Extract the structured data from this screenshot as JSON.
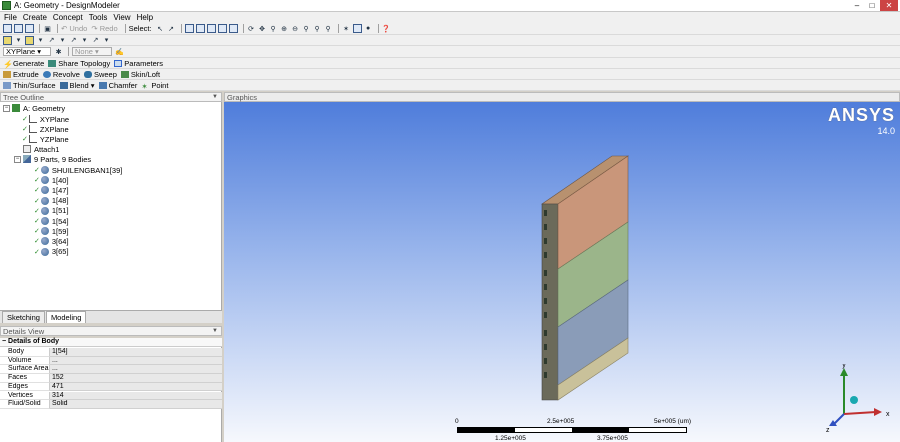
{
  "window": {
    "title": "A: Geometry - DesignModeler"
  },
  "menu": [
    "File",
    "Create",
    "Concept",
    "Tools",
    "View",
    "Help"
  ],
  "toolbar1": {
    "undo": "Undo",
    "redo": "Redo",
    "select": "Select:"
  },
  "plane_toolbar": {
    "plane": "XYPlane",
    "sketch": "None"
  },
  "feature_toolbar": {
    "generate": "Generate",
    "share": "Share Topology",
    "params": "Parameters"
  },
  "ops_toolbar": {
    "extrude": "Extrude",
    "revolve": "Revolve",
    "sweep": "Sweep",
    "skin": "Skin/Loft"
  },
  "ops_toolbar2": {
    "thin": "Thin/Surface",
    "blend": "Blend",
    "chamfer": "Chamfer",
    "point": "Point"
  },
  "tree": {
    "header": "Tree Outline",
    "root": "A: Geometry",
    "items": [
      {
        "label": "XYPlane",
        "icon": "plane-icon"
      },
      {
        "label": "ZXPlane",
        "icon": "plane-icon"
      },
      {
        "label": "YZPlane",
        "icon": "plane-icon"
      },
      {
        "label": "Attach1",
        "icon": "attach-icon"
      }
    ],
    "parts": "9 Parts, 9 Bodies",
    "bodies": [
      "SHUILENGBAN1[39]",
      "1[40]",
      "1[47]",
      "1[48]",
      "1[51]",
      "1[54]",
      "1[59]",
      "3[64]",
      "3[65]"
    ]
  },
  "tabs": [
    "Sketching",
    "Modeling"
  ],
  "details": {
    "header": "Details View",
    "title": "Details of Body",
    "rows": [
      {
        "key": "Body",
        "value": "1[54]"
      },
      {
        "key": "Volume",
        "value": "..."
      },
      {
        "key": "Surface Area",
        "value": "..."
      },
      {
        "key": "Faces",
        "value": "152"
      },
      {
        "key": "Edges",
        "value": "471"
      },
      {
        "key": "Vertices",
        "value": "314"
      },
      {
        "key": "Fluid/Solid",
        "value": "Solid"
      }
    ]
  },
  "graphics": {
    "header": "Graphics",
    "logo": "ANSYS",
    "version": "14.0",
    "scale": {
      "t0": "0",
      "t1": "2.5e+005",
      "t2": "5e+005 (um)",
      "b1": "1.25e+005",
      "b2": "3.75e+005"
    }
  },
  "colors": {
    "accent": "#2a8a2a",
    "viewport_top": "#4f7ddb",
    "viewport_bottom": "#f6f8fd"
  }
}
